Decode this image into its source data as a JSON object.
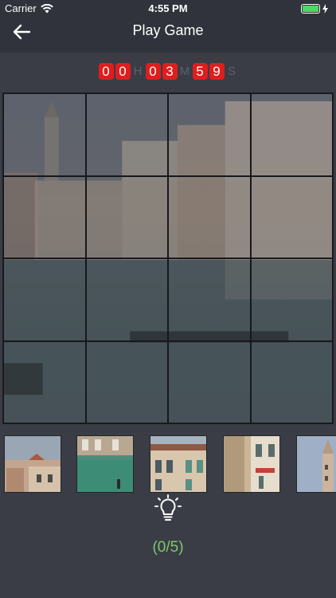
{
  "status_bar": {
    "carrier": "Carrier",
    "time": "4:55 PM",
    "icons": [
      "wifi-icon",
      "battery-icon",
      "charging-bolt-icon"
    ]
  },
  "nav": {
    "title": "Play Game",
    "back_icon": "back-arrow-icon"
  },
  "timer": {
    "hours": [
      "0",
      "0"
    ],
    "hours_unit": "H",
    "minutes": [
      "0",
      "3"
    ],
    "minutes_unit": "M",
    "seconds": [
      "5",
      "9"
    ],
    "seconds_unit": "S"
  },
  "board": {
    "rows": 4,
    "columns": 4
  },
  "pieces": {
    "count_visible": 5
  },
  "hint": {
    "icon": "lightbulb-icon",
    "score": "(0/5)"
  },
  "colors": {
    "background": "#3a3d46",
    "timer_digit": "#e01d1d",
    "score_text": "#7ec96b"
  }
}
